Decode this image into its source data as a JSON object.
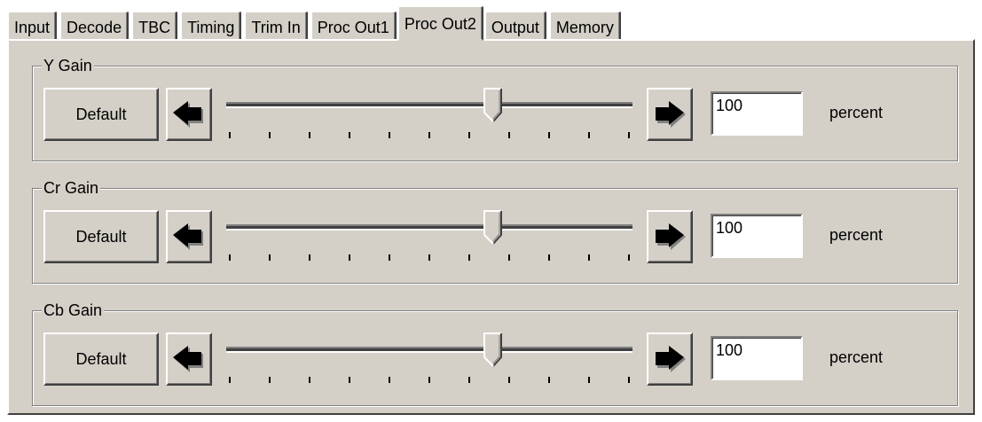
{
  "tabs": [
    {
      "label": "Input",
      "active": false
    },
    {
      "label": "Decode",
      "active": false
    },
    {
      "label": "TBC",
      "active": false
    },
    {
      "label": "Timing",
      "active": false
    },
    {
      "label": "Trim In",
      "active": false
    },
    {
      "label": "Proc Out1",
      "active": false
    },
    {
      "label": "Proc Out2",
      "active": true
    },
    {
      "label": "Output",
      "active": false
    },
    {
      "label": "Memory",
      "active": false
    }
  ],
  "groups": [
    {
      "title": "Y Gain",
      "default_label": "Default",
      "value": "100",
      "unit": "percent",
      "slider_fraction": 0.66
    },
    {
      "title": "Cr Gain",
      "default_label": "Default",
      "value": "100",
      "unit": "percent",
      "slider_fraction": 0.66
    },
    {
      "title": "Cb Gain",
      "default_label": "Default",
      "value": "100",
      "unit": "percent",
      "slider_fraction": 0.66
    }
  ],
  "icons": {
    "decrease": "arrow-left-icon",
    "increase": "arrow-right-icon",
    "slider_thumb": "slider-thumb"
  },
  "colors": {
    "face": "#d4d0c8",
    "highlight": "#ffffff",
    "shadow": "#808080",
    "dark_shadow": "#404040"
  }
}
